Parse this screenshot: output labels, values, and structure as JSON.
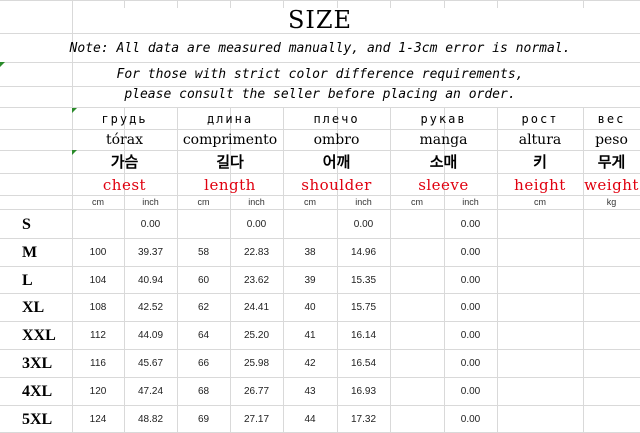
{
  "title": "SIZE",
  "notes": [
    "Note: All data are measured manually, and 1-3cm error is normal.",
    "For those with strict color difference requirements,",
    "please consult the seller before placing an order."
  ],
  "columns": [
    {
      "ru": "грудь",
      "pt": "tórax",
      "ko": "가슴",
      "en": "chest",
      "units": [
        "cm",
        "inch"
      ]
    },
    {
      "ru": "длина",
      "pt": "comprimento",
      "ko": "길다",
      "en": "length",
      "units": [
        "cm",
        "inch"
      ]
    },
    {
      "ru": "плечо",
      "pt": "ombro",
      "ko": "어깨",
      "en": "shoulder",
      "units": [
        "cm",
        "inch"
      ]
    },
    {
      "ru": "рукав",
      "pt": "manga",
      "ko": "소매",
      "en": "sleeve",
      "units": [
        "cm",
        "inch"
      ]
    },
    {
      "ru": "рост",
      "pt": "altura",
      "ko": "키",
      "en": "height",
      "units": [
        "cm"
      ]
    },
    {
      "ru": "вес",
      "pt": "peso",
      "ko": "무게",
      "en": "weight",
      "units": [
        "kg"
      ]
    }
  ],
  "rows": [
    {
      "size": "S",
      "chest_cm": "",
      "chest_in": "0.00",
      "length_cm": "",
      "length_in": "0.00",
      "shoulder_cm": "",
      "shoulder_in": "0.00",
      "sleeve_cm": "",
      "sleeve_in": "0.00",
      "height_cm": "",
      "weight_kg": ""
    },
    {
      "size": "M",
      "chest_cm": "100",
      "chest_in": "39.37",
      "length_cm": "58",
      "length_in": "22.83",
      "shoulder_cm": "38",
      "shoulder_in": "14.96",
      "sleeve_cm": "",
      "sleeve_in": "0.00",
      "height_cm": "",
      "weight_kg": ""
    },
    {
      "size": "L",
      "chest_cm": "104",
      "chest_in": "40.94",
      "length_cm": "60",
      "length_in": "23.62",
      "shoulder_cm": "39",
      "shoulder_in": "15.35",
      "sleeve_cm": "",
      "sleeve_in": "0.00",
      "height_cm": "",
      "weight_kg": ""
    },
    {
      "size": "XL",
      "chest_cm": "108",
      "chest_in": "42.52",
      "length_cm": "62",
      "length_in": "24.41",
      "shoulder_cm": "40",
      "shoulder_in": "15.75",
      "sleeve_cm": "",
      "sleeve_in": "0.00",
      "height_cm": "",
      "weight_kg": ""
    },
    {
      "size": "XXL",
      "chest_cm": "112",
      "chest_in": "44.09",
      "length_cm": "64",
      "length_in": "25.20",
      "shoulder_cm": "41",
      "shoulder_in": "16.14",
      "sleeve_cm": "",
      "sleeve_in": "0.00",
      "height_cm": "",
      "weight_kg": ""
    },
    {
      "size": "3XL",
      "chest_cm": "116",
      "chest_in": "45.67",
      "length_cm": "66",
      "length_in": "25.98",
      "shoulder_cm": "42",
      "shoulder_in": "16.54",
      "sleeve_cm": "",
      "sleeve_in": "0.00",
      "height_cm": "",
      "weight_kg": ""
    },
    {
      "size": "4XL",
      "chest_cm": "120",
      "chest_in": "47.24",
      "length_cm": "68",
      "length_in": "26.77",
      "shoulder_cm": "43",
      "shoulder_in": "16.93",
      "sleeve_cm": "",
      "sleeve_in": "0.00",
      "height_cm": "",
      "weight_kg": ""
    },
    {
      "size": "5XL",
      "chest_cm": "124",
      "chest_in": "48.82",
      "length_cm": "69",
      "length_in": "27.17",
      "shoulder_cm": "44",
      "shoulder_in": "17.32",
      "sleeve_cm": "",
      "sleeve_in": "0.00",
      "height_cm": "",
      "weight_kg": ""
    }
  ]
}
